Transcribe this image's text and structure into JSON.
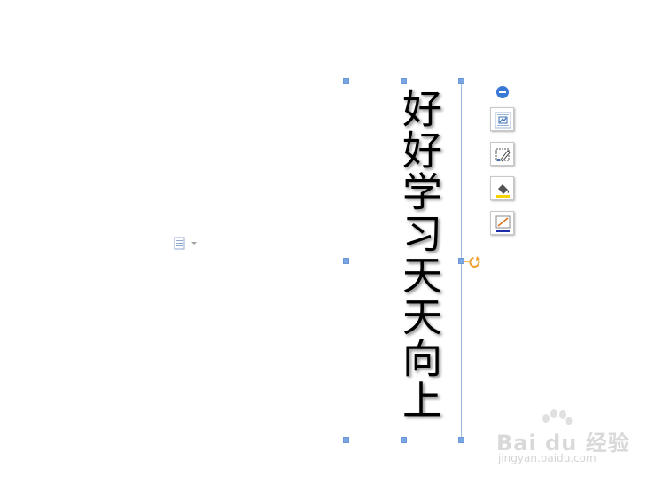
{
  "document": {
    "textbox_text": "好好学习天天向上"
  },
  "toolbar": {
    "collapse_icon": "minus-circle-icon",
    "buttons": [
      {
        "icon": "layout-options-icon"
      },
      {
        "icon": "edit-shape-icon"
      },
      {
        "icon": "fill-color-icon",
        "accent": "#f5d300"
      },
      {
        "icon": "line-color-icon",
        "accent": "#1a2fa8"
      }
    ]
  },
  "watermark": {
    "logo": "Bai du 经验",
    "url": "jingyan.baidu.com"
  },
  "colors": {
    "selection": "#7aa5e3",
    "rotate_handle": "#f0a030"
  }
}
